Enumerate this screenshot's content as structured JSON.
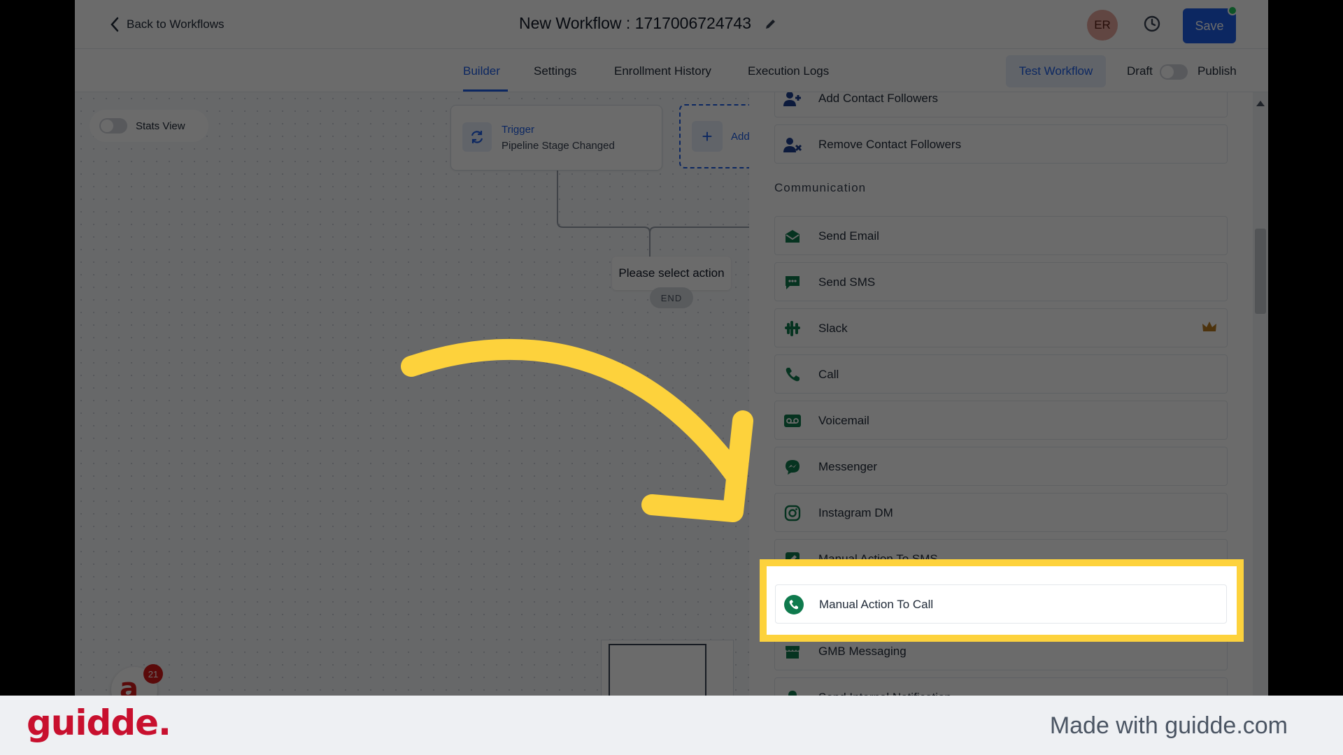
{
  "header": {
    "back_label": "Back to Workflows",
    "title": "New Workflow : 1717006724743",
    "avatar_initials": "ER",
    "save_label": "Save"
  },
  "tabs": [
    {
      "label": "Builder",
      "active": true
    },
    {
      "label": "Settings",
      "active": false
    },
    {
      "label": "Enrollment History",
      "active": false
    },
    {
      "label": "Execution Logs",
      "active": false
    }
  ],
  "toolbar": {
    "test_workflow_label": "Test Workflow",
    "draft_label": "Draft",
    "publish_label": "Publish"
  },
  "canvas": {
    "stats_view_label": "Stats View",
    "trigger_title": "Trigger",
    "trigger_subtitle": "Pipeline Stage Changed",
    "add_label": "Add",
    "select_action_label": "Please select action",
    "end_label": "END"
  },
  "side_panel": {
    "items_top": [
      {
        "label": "Add Contact Followers",
        "icon": "add-user-icon"
      },
      {
        "label": "Remove Contact Followers",
        "icon": "remove-user-icon"
      }
    ],
    "section_title": "Communication",
    "communication_items": [
      {
        "label": "Send Email",
        "icon": "email-icon"
      },
      {
        "label": "Send SMS",
        "icon": "sms-icon"
      },
      {
        "label": "Slack",
        "icon": "slack-icon",
        "premium": true
      },
      {
        "label": "Call",
        "icon": "phone-icon"
      },
      {
        "label": "Voicemail",
        "icon": "voicemail-icon"
      },
      {
        "label": "Messenger",
        "icon": "messenger-icon"
      },
      {
        "label": "Instagram DM",
        "icon": "instagram-icon"
      },
      {
        "label": "Manual Action To SMS",
        "icon": "manual-sms-icon"
      },
      {
        "label": "Manual Action To Call",
        "icon": "manual-call-icon",
        "highlighted": true
      },
      {
        "label": "GMB Messaging",
        "icon": "gmb-icon"
      },
      {
        "label": "Send Internal Notification",
        "icon": "notification-icon"
      }
    ]
  },
  "launcher": {
    "badge_count": "21"
  },
  "footer": {
    "logo": "guidde.",
    "made_with": "Made with guidde.com"
  },
  "colors": {
    "accent": "#1d5ee8",
    "highlight": "#fdd23c",
    "icon_green": "#0f7a4d",
    "brand_red": "#c8102e"
  }
}
